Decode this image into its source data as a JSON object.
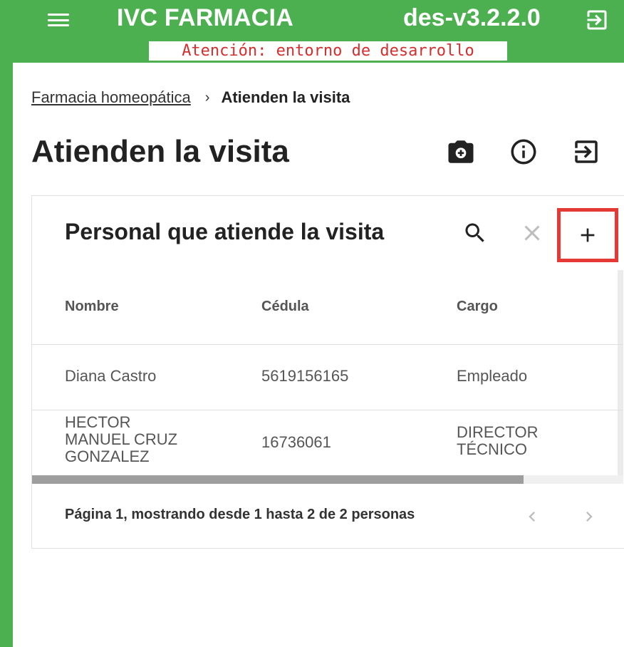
{
  "header": {
    "app_title": "IVC FARMACIA",
    "version": "des-v3.2.2.0",
    "env_warning": "Atención: entorno de desarrollo",
    "menu_icon": "menu-icon",
    "logout_icon": "logout-icon",
    "background_color": "#4caf50"
  },
  "breadcrumb": {
    "parent": "Farmacia homeopática",
    "separator": "›",
    "current": "Atienden la visita"
  },
  "page": {
    "title": "Atienden la visita",
    "actions": [
      "camera-icon",
      "info-icon",
      "logout-icon"
    ]
  },
  "card": {
    "title": "Personal que atiende la visita",
    "actions": [
      "search-icon",
      "close-icon",
      "add-icon"
    ],
    "highlight_color": "#e53935",
    "columns": [
      "Nombre",
      "Cédula",
      "Cargo"
    ],
    "rows": [
      {
        "nombre": "Diana Castro",
        "cedula": "5619156165",
        "cargo": "Empleado"
      },
      {
        "nombre": "HECTOR\nMANUEL CRUZ\nGONZALEZ",
        "cedula": "16736061",
        "cargo": "DIRECTOR\nTÉCNICO"
      }
    ],
    "pagination": {
      "text": "Página 1, mostrando desde 1 hasta 2 de 2 personas",
      "prev_icon": "chevron-left-icon",
      "next_icon": "chevron-right-icon"
    }
  }
}
